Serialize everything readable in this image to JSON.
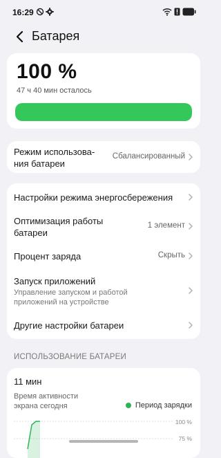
{
  "status_bar": {
    "time": "16:29"
  },
  "header": {
    "title": "Батарея"
  },
  "battery": {
    "percent_text": "100 %",
    "remaining": "47 ч 40 мин осталось",
    "level": 1.0,
    "color": "#34c759"
  },
  "mode_row": {
    "label": "Режим использова-\nния батареи",
    "value": "Сбалансированный"
  },
  "settings": {
    "power_saving": {
      "label": "Настройки режима энергосбережения"
    },
    "optimization": {
      "label": "Оптимизация работы\nбатареи",
      "value": "1 элемент"
    },
    "charge_percent": {
      "label": "Процент заряда",
      "value": "Скрыть"
    },
    "app_launch": {
      "label": "Запуск приложений",
      "sublabel": "Управление запуском и работой\nприложений на устройстве"
    },
    "other": {
      "label": "Другие настройки батареи"
    }
  },
  "usage": {
    "section_title": "ИСПОЛЬЗОВАНИЕ БАТАРЕИ",
    "screen_time": "11 мин",
    "screen_time_desc": "Время активности\nэкрана сегодня",
    "legend_label": "Период зарядки",
    "legend_color": "#2db354"
  },
  "chart_data": {
    "type": "area",
    "yticks": [
      "100 %",
      "75 %"
    ],
    "x": [
      0,
      1,
      2,
      3
    ],
    "y": [
      60,
      95,
      100,
      100
    ]
  }
}
